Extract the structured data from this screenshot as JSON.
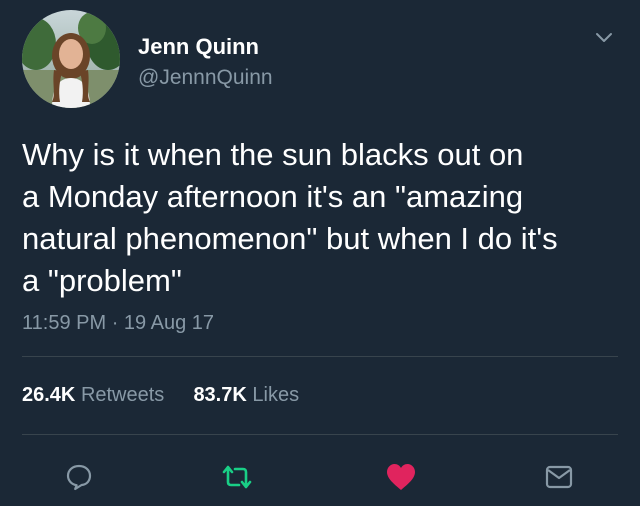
{
  "author": {
    "name": "Jenn Quinn",
    "handle": "@JennnQuinn"
  },
  "tweet": {
    "lines": [
      "Why is it when the sun blacks out on",
      "a Monday afternoon it's an \"amazing",
      "natural phenomenon\" but when I do it's",
      "a \"problem\""
    ],
    "time": "11:59 PM",
    "separator": "·",
    "date": "19 Aug 17"
  },
  "stats": {
    "retweets_count": "26.4K",
    "retweets_label": "Retweets",
    "likes_count": "83.7K",
    "likes_label": "Likes"
  },
  "actions": {
    "reply_icon": "reply-icon",
    "retweet_icon": "retweet-icon",
    "like_icon": "heart-icon",
    "dm_icon": "envelope-icon"
  },
  "colors": {
    "background": "#1b2836",
    "text_primary": "#ffffff",
    "text_secondary": "#8899a6",
    "retweet_active": "#19cf86",
    "like_active": "#e0245e",
    "divider": "#38444d"
  }
}
